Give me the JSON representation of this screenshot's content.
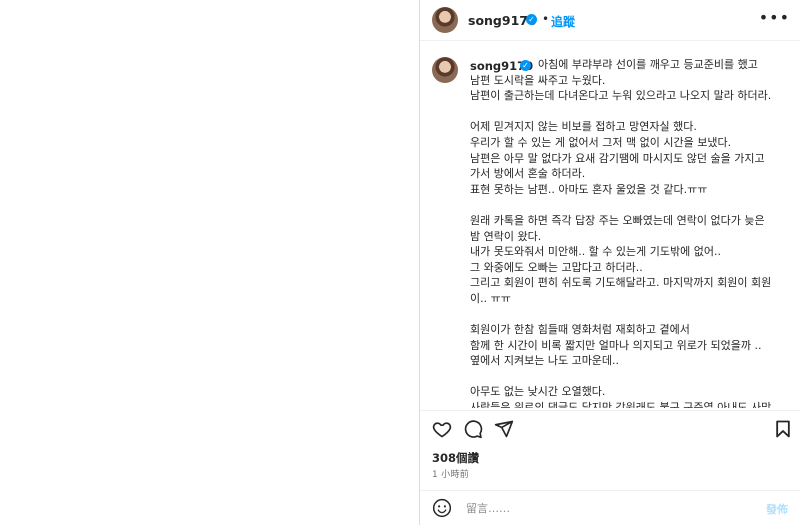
{
  "post": {
    "username": "song9170",
    "follow_label": "追蹤",
    "dot": "•",
    "more": "•••"
  },
  "caption": {
    "username": "song9170",
    "first_line": "아침에 부랴부랴 선이를 깨우고 등교준비를 했고",
    "lines": [
      "남편 도시락을 싸주고 누웠다.",
      "남편이 출근하는데 다녀온다고 누워 있으라고 나오지 말라 하더라.",
      "",
      "어제 믿겨지지 않는 비보를 접하고 망연자실 했다.",
      "우리가 할 수 있는 게 없어서 그저 맥 없이 시간을 보냈다.",
      "남편은 아무 말 없다가 요새 감기땜에 마시지도 않던 술을 가지고 가서 방에서 혼술 하더라.",
      "표현 못하는 남편.. 아마도 혼자 울었을 것 같다.ㅠㅠ",
      "",
      "원래 카톡을 하면 즉각 답장 주는 오빠였는데 연락이 없다가 늦은 밤 연락이 왔다.",
      "내가 못도와줘서 미안해.. 할 수 있는게 기도밖에 없어..",
      "그 와중에도 오빠는 고맙다고 하더라..",
      "그리고 회원이 편히 쉬도록 기도해달라고. 마지막까지 회원이 회원이.. ㅠㅠ",
      "",
      "회원이가 한참 힘들때 영화처럼 재회하고 곁에서",
      "함께 한 시간이 비록 짧지만 얼마나 의지되고 위로가 되었을까 ..",
      "옆에서 지켜보는 나도 고마운데..",
      "",
      "아무도 없는 낮시간 오열했다.",
      "사람들은 위로의 댓글도 달지만 강원래도 불구 구준엽 아내도 사망"
    ]
  },
  "stats": {
    "likes": "308個讚",
    "time": "1 小時前"
  },
  "comment": {
    "placeholder": "留言……",
    "post_label": "發佈"
  },
  "colors": {
    "accent": "#0095f6",
    "verified": "#0095f6",
    "muted": "#737373",
    "divider": "#dbdbdb"
  },
  "icons": {
    "like": "heart-icon",
    "comment": "comment-icon",
    "share": "share-icon",
    "save": "bookmark-icon",
    "emoji": "emoji-icon",
    "verified": "verified-badge-icon",
    "more": "more-options-icon"
  }
}
